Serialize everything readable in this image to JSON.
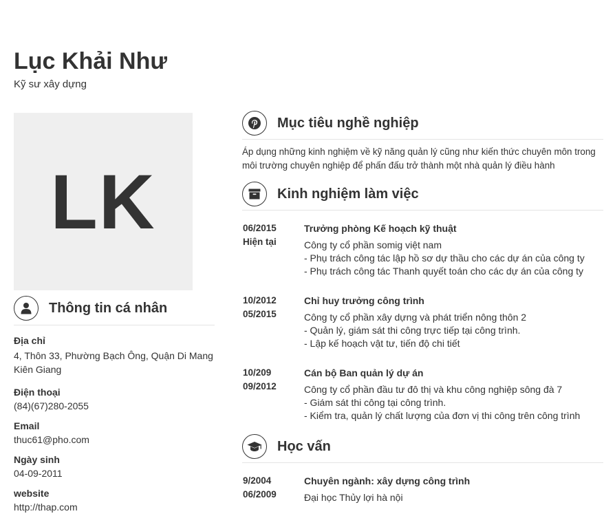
{
  "header": {
    "name": "Lục Khải Như",
    "job_title": "Kỹ sư xây dựng"
  },
  "avatar": {
    "initials": "LK"
  },
  "personal": {
    "title": "Thông tin cá nhân",
    "items": [
      {
        "label": "Địa chỉ",
        "value": "4, Thôn 33, Phường Bạch Ông, Quận Di Mang Kiên Giang"
      },
      {
        "label": "Điện thoại",
        "value": "(84)(67)280-2055"
      },
      {
        "label": "Email",
        "value": "thuc61@pho.com"
      },
      {
        "label": "Ngày sinh",
        "value": "04-09-2011"
      },
      {
        "label": "website",
        "value": "http://thap.com"
      }
    ]
  },
  "objective": {
    "title": "Mục tiêu nghề nghiệp",
    "text": "Áp dụng những kinh nghiệm về kỹ năng quản lý cũng như kiến thức chuyên môn trong môi trường chuyên nghiệp để phấn đấu trở thành một nhà quản lý điều hành"
  },
  "experience": {
    "title": "Kinh nghiệm làm việc",
    "items": [
      {
        "from": "06/2015",
        "to": "Hiện tại",
        "role": "Trưởng phòng Kế hoạch kỹ thuật",
        "company": "Công ty cổ phần somig việt nam",
        "lines": [
          "- Phụ trách công tác lập hồ sơ dự thầu cho các dự án của công ty",
          "- Phụ trách công tác Thanh quyết toán cho các dự án của công ty"
        ]
      },
      {
        "from": "10/2012",
        "to": "05/2015",
        "role": "Chỉ huy trưởng công trình",
        "company": "Công ty cổ phần xây dựng và phát triển nông thôn 2",
        "lines": [
          "- Quản lý, giám sát thi công trực tiếp tại công trình.",
          "- Lập kế hoạch vật tư, tiến độ chi tiết"
        ]
      },
      {
        "from": "10/209",
        "to": "09/2012",
        "role": "Cán bộ Ban quản lý dự án",
        "company": "Công ty cổ phần đầu tư đô thị và khu công nghiệp sông đà 7",
        "lines": [
          "- Giám sát thi công tại công trình.",
          "- Kiểm tra, quản lý chất lượng của đơn vị thi công trên công trình"
        ]
      }
    ]
  },
  "education": {
    "title": "Học vấn",
    "items": [
      {
        "from": "9/2004",
        "to": "06/2009",
        "role": "Chuyên ngành: xây dựng công trình",
        "company": "Đại học Thủy lợi hà nội"
      }
    ]
  },
  "icons": {
    "personal": "user-icon",
    "objective": "pinterest-icon",
    "experience": "archive-box-icon",
    "education": "graduation-cap-icon"
  }
}
